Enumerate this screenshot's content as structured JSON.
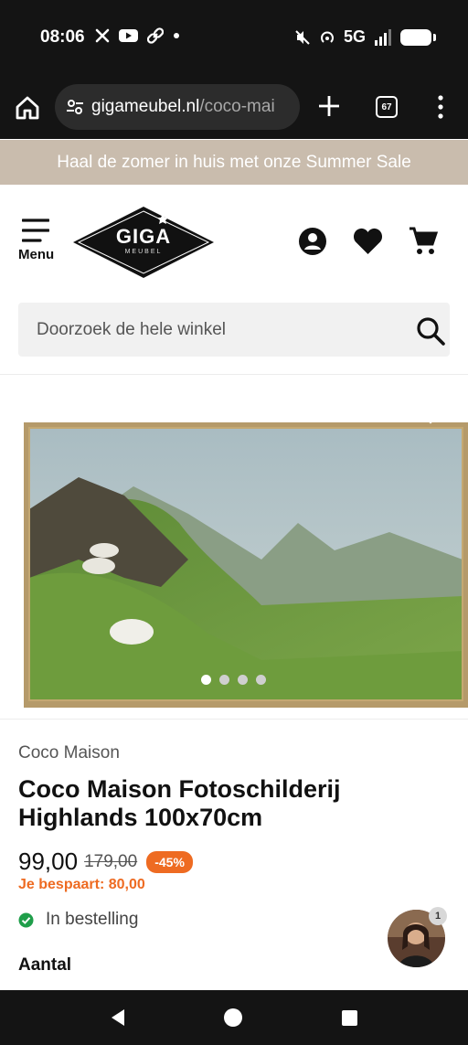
{
  "status_bar": {
    "time": "08:06",
    "network": "5G"
  },
  "browser": {
    "url_host": "gigameubel.nl",
    "url_path": "/coco-mai",
    "tab_count": "67"
  },
  "promo": {
    "text": "Haal de zomer in huis met onze Summer Sale"
  },
  "header": {
    "menu_label": "Menu",
    "logo_text": "GIGA",
    "logo_sub": "MEUBEL"
  },
  "search": {
    "placeholder": "Doorzoek de hele winkel"
  },
  "gallery": {
    "image_count": 4,
    "active_index": 0
  },
  "product": {
    "brand": "Coco Maison",
    "title": "Coco Maison Fotoschilderij Highlands 100x70cm",
    "price": "99,00",
    "old_price": "179,00",
    "discount": "-45%",
    "savings": "Je bespaart: 80,00",
    "stock_status": "In bestelling",
    "quantity_label": "Aantal"
  },
  "chat": {
    "badge_count": "1"
  },
  "colors": {
    "promo_bg": "#c9bcad",
    "accent_orange": "#ee6b22",
    "stock_green": "#1f9e4a",
    "system_bar": "#141414"
  },
  "icons": [
    "x-icon",
    "youtube-icon",
    "link-icon",
    "mute-icon",
    "hotspot-icon",
    "signal-icon",
    "battery-icon",
    "home-icon",
    "tune-icon",
    "plus-icon",
    "menu-dots-icon",
    "hamburger-icon",
    "account-icon",
    "heart-icon",
    "cart-icon",
    "search-icon",
    "check-circle-icon"
  ]
}
